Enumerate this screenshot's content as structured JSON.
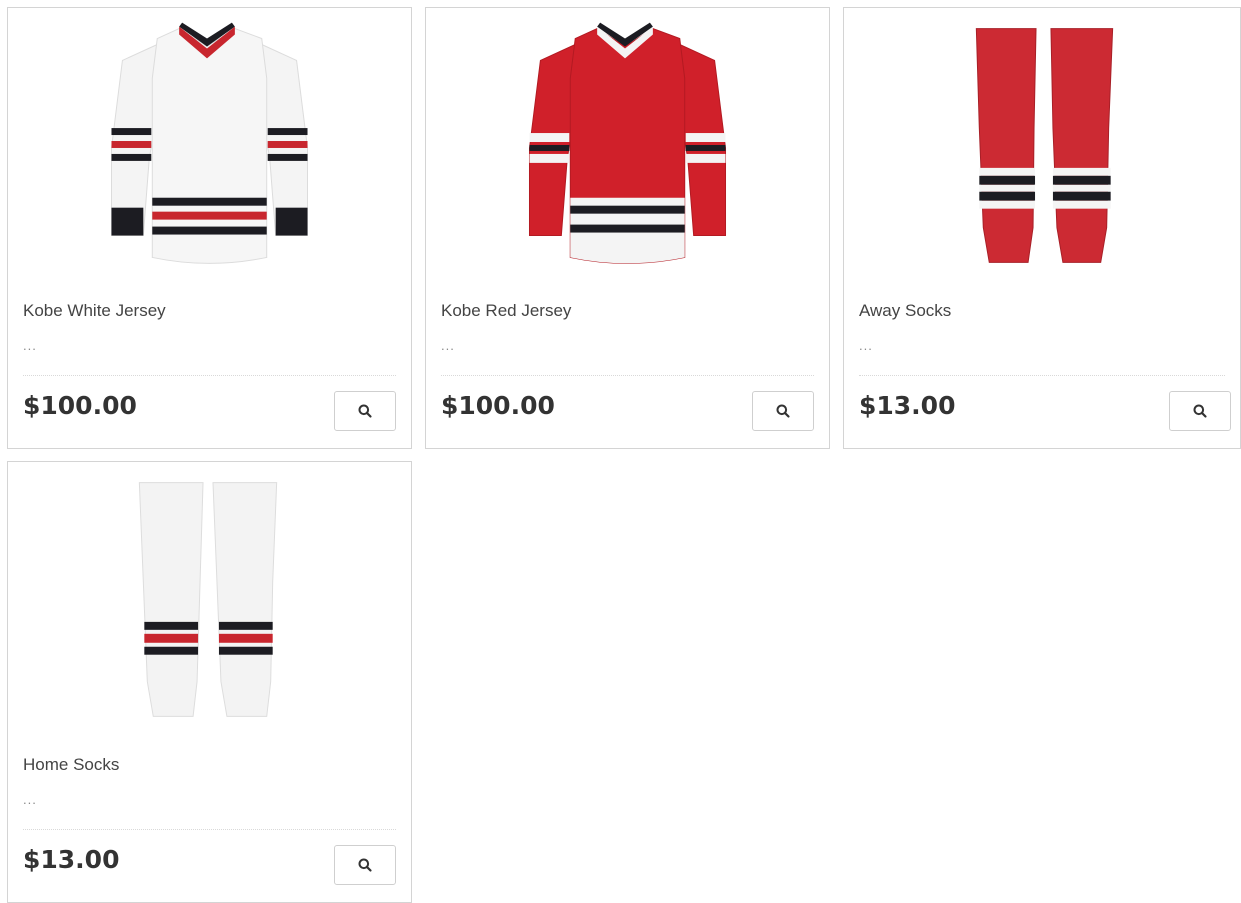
{
  "products": [
    {
      "name": "Kobe White Jersey",
      "description": "...",
      "price": "$100.00",
      "image_icon": "white-hockey-jersey-icon",
      "action_icon": "search-icon"
    },
    {
      "name": "Kobe Red Jersey",
      "description": "...",
      "price": "$100.00",
      "image_icon": "red-hockey-jersey-icon",
      "action_icon": "search-icon"
    },
    {
      "name": "Away Socks",
      "description": "...",
      "price": "$13.00",
      "image_icon": "red-hockey-socks-icon",
      "action_icon": "search-icon"
    },
    {
      "name": "Home Socks",
      "description": "...",
      "price": "$13.00",
      "image_icon": "white-hockey-socks-icon",
      "action_icon": "search-icon"
    }
  ],
  "colors": {
    "jersey_red": "#d0202a",
    "stripe_black": "#1c1c22",
    "jersey_white": "#f4f4f4",
    "price_text": "#333333",
    "card_border": "#d4d4d4"
  }
}
